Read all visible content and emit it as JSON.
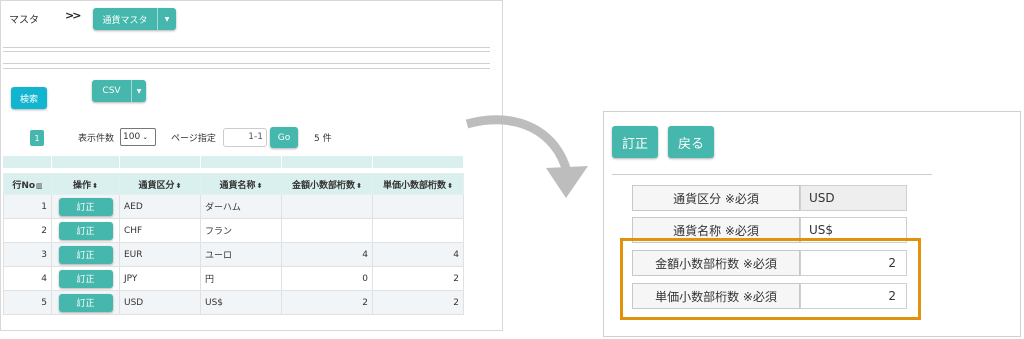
{
  "left": {
    "breadcrumb": "マスタ",
    "breadcrumb_sep": ">>",
    "menu_label": "通貨マスタ",
    "search_label": "検索",
    "csv_label": "CSV",
    "pager": {
      "current_page": "1",
      "per_page_label": "表示件数",
      "per_page_value": "100",
      "page_jump_label": "ページ指定",
      "page_range": "1-1",
      "go_label": "Go",
      "count": "5 件"
    },
    "columns": [
      "行No",
      "操作",
      "通貨区分",
      "通貨名称",
      "金額小数部桁数",
      "単価小数部桁数"
    ],
    "rows": [
      {
        "no": "1",
        "action": "訂正",
        "code": "AED",
        "name": "ダーハム",
        "amt": "",
        "unit": ""
      },
      {
        "no": "2",
        "action": "訂正",
        "code": "CHF",
        "name": "フラン",
        "amt": "",
        "unit": ""
      },
      {
        "no": "3",
        "action": "訂正",
        "code": "EUR",
        "name": "ユーロ",
        "amt": "4",
        "unit": "4"
      },
      {
        "no": "4",
        "action": "訂正",
        "code": "JPY",
        "name": "円",
        "amt": "0",
        "unit": "2"
      },
      {
        "no": "5",
        "action": "訂正",
        "code": "USD",
        "name": "US$",
        "amt": "2",
        "unit": "2"
      }
    ]
  },
  "right": {
    "fix_label": "訂正",
    "back_label": "戻る",
    "fields": [
      {
        "label": "通貨区分 ※必須",
        "value": "USD"
      },
      {
        "label": "通貨名称 ※必須",
        "value": "US$"
      },
      {
        "label": "金額小数部桁数 ※必須",
        "value": "2"
      },
      {
        "label": "単価小数部桁数 ※必須",
        "value": "2"
      }
    ]
  },
  "colors": {
    "teal": "#45b7ac",
    "search_blue": "#12b5cf",
    "highlight_orange": "#e0920d",
    "header_bg": "#d9f0ee"
  }
}
